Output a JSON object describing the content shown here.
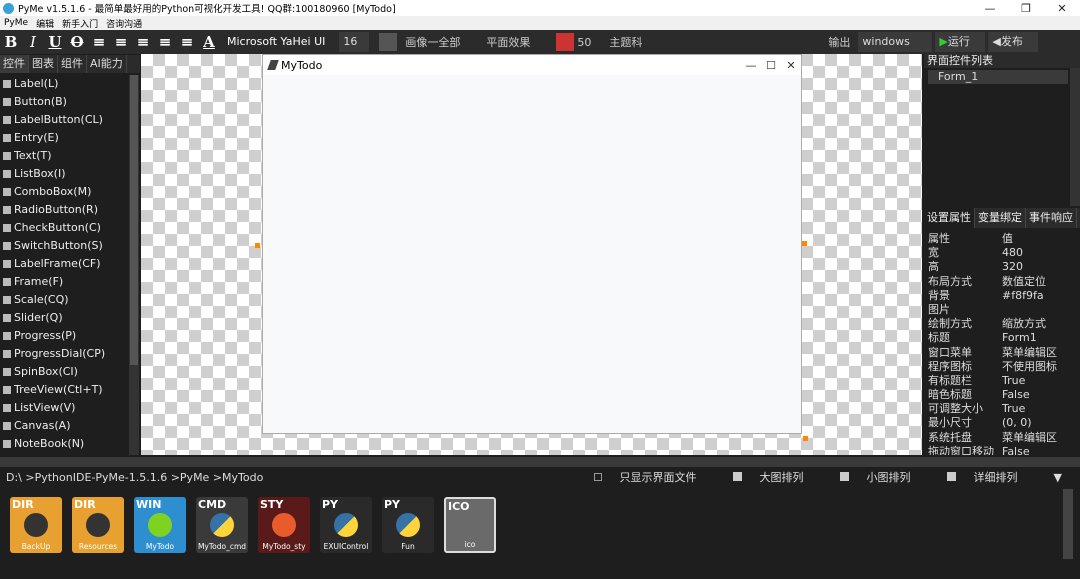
{
  "window": {
    "title": "PyMe v1.5.1.6 - 最简单最好用的Python可视化开发工具! QQ群:100180960    [MyTodo]"
  },
  "menu": [
    "PyMe",
    "编辑",
    "新手入门",
    "咨询沟通"
  ],
  "toolbar": {
    "format_buttons": [
      "B",
      "I",
      "U",
      "O",
      "≡",
      "≡",
      "≡",
      "≡",
      "≡",
      "A"
    ],
    "font_name": "Microsoft YaHei UI",
    "font_size": "16",
    "image_label": "画像一全部",
    "flat_effect": "平面效果",
    "opacity": "50",
    "theme": "主题科",
    "output_label": "输出",
    "platform": "windows",
    "run_label": "运行",
    "publish_label": "发布"
  },
  "left_tabs": [
    "控件",
    "图表",
    "组件",
    "AI能力"
  ],
  "widgets": [
    "Label(L)",
    "Button(B)",
    "LabelButton(CL)",
    "Entry(E)",
    "Text(T)",
    "ListBox(I)",
    "ComboBox(M)",
    "RadioButton(R)",
    "CheckButton(C)",
    "SwitchButton(S)",
    "LabelFrame(CF)",
    "Frame(F)",
    "Scale(CQ)",
    "Slider(Q)",
    "Progress(P)",
    "ProgressDial(CP)",
    "SpinBox(CI)",
    "TreeView(Ctl+T)",
    "ListView(V)",
    "Canvas(A)",
    "NoteBook(N)"
  ],
  "form": {
    "title": "MyTodo",
    "background": "#f8f9fa"
  },
  "right_panel": {
    "tree_title": "界面控件列表",
    "tree_item": "Form_1",
    "prop_tabs": [
      "设置属性",
      "变量绑定",
      "事件响应"
    ],
    "prop_header": {
      "key": "属性",
      "value": "值"
    },
    "props": [
      [
        "宽",
        "480"
      ],
      [
        "高",
        "320"
      ],
      [
        "布局方式",
        "数值定位"
      ],
      [
        "背景",
        "#f8f9fa"
      ],
      [
        "图片",
        ""
      ],
      [
        "绘制方式",
        "缩放方式"
      ],
      [
        "标题",
        "Form1"
      ],
      [
        "窗口菜单",
        "菜单编辑区"
      ],
      [
        "程序图标",
        "不使用图标"
      ],
      [
        "有标题栏",
        "True"
      ],
      [
        "暗色标题",
        "False"
      ],
      [
        "可调整大小",
        "True"
      ],
      [
        "最小尺寸",
        "(0, 0)"
      ],
      [
        "系统托盘",
        "菜单编辑区"
      ],
      [
        "拖动窗口移动",
        "False"
      ]
    ]
  },
  "pathbar": {
    "path": "D:\\ >PythonIDE-PyMe-1.5.1.6 >PyMe >MyTodo",
    "only_ui_files": "只显示界面文件",
    "large_icons": "大图排列",
    "small_icons": "小图排列",
    "details": "详细排列"
  },
  "files": [
    {
      "type": "DIR",
      "name": "BackUp",
      "color": "#e8a030"
    },
    {
      "type": "DIR",
      "name": "Resources",
      "color": "#e8a030"
    },
    {
      "type": "WIN",
      "name": "MyTodo",
      "color": "#2e8fd0"
    },
    {
      "type": "CMD",
      "name": "MyTodo_cmd",
      "color": "#3a3a3a"
    },
    {
      "type": "STY",
      "name": "MyTodo_sty",
      "color": "#5a1a1a"
    },
    {
      "type": "PY",
      "name": "EXUIControl",
      "color": "#2a2a2a"
    },
    {
      "type": "PY",
      "name": "Fun",
      "color": "#2a2a2a"
    },
    {
      "type": "ICO",
      "name": "ico",
      "color": "#6a6a6a"
    }
  ]
}
